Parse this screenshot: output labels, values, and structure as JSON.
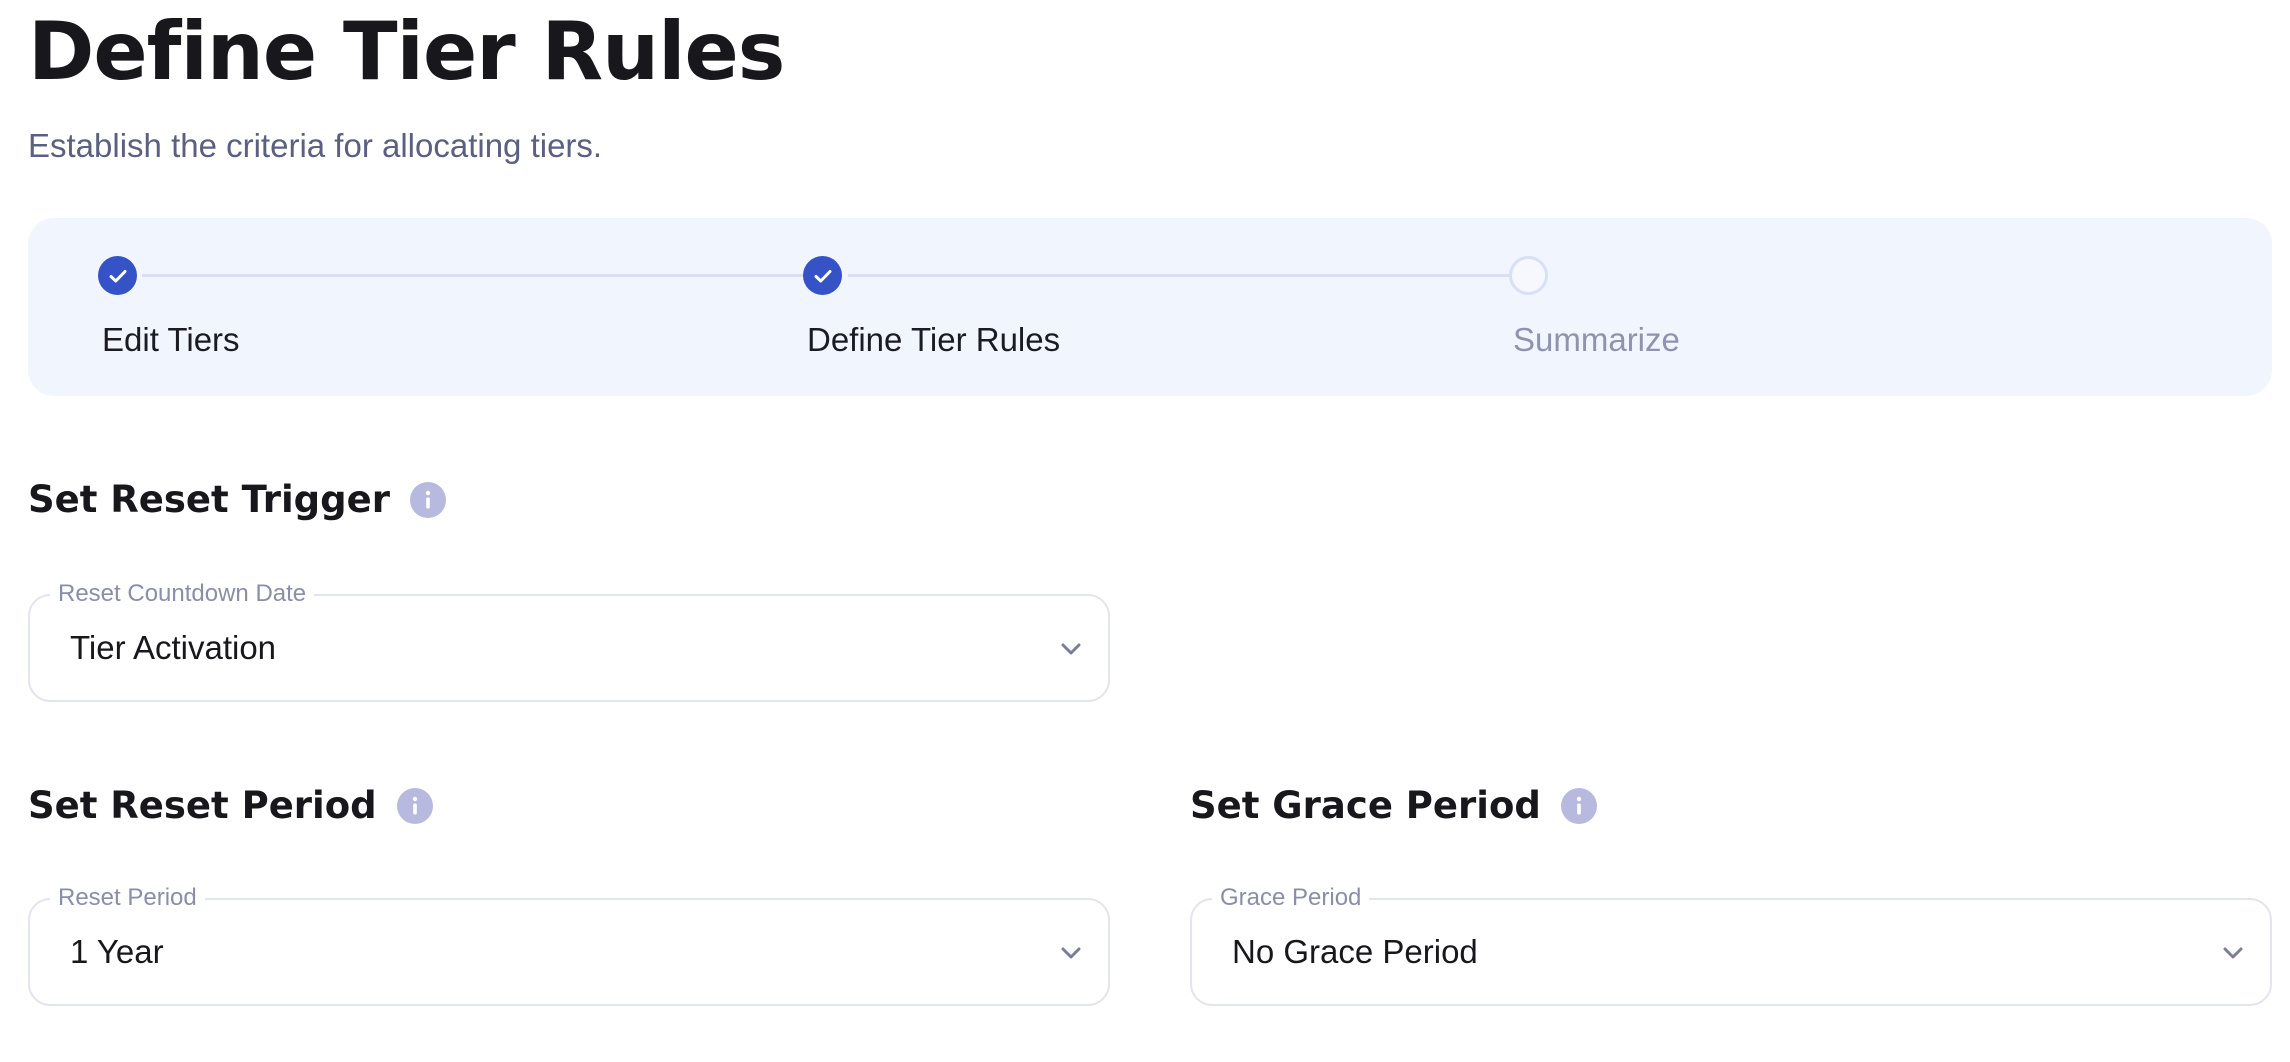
{
  "header": {
    "title": "Define Tier Rules",
    "subtitle": "Establish the criteria for allocating tiers."
  },
  "stepper": {
    "steps": [
      {
        "label": "Edit Tiers",
        "status": "completed"
      },
      {
        "label": "Define Tier Rules",
        "status": "completed"
      },
      {
        "label": "Summarize",
        "status": "pending"
      }
    ]
  },
  "reset_trigger": {
    "title": "Set Reset Trigger",
    "field_label": "Reset Countdown Date",
    "value": "Tier Activation"
  },
  "reset_period": {
    "title": "Set Reset Period",
    "field_label": "Reset Period",
    "value": "1 Year"
  },
  "grace_period": {
    "title": "Set Grace Period",
    "field_label": "Grace Period",
    "value": "No Grace Period"
  },
  "icons": {
    "step_done": "check-icon",
    "info": "info-icon",
    "dropdown": "chevron-down-icon"
  },
  "colors": {
    "accent": "#3552c7",
    "stepper_bg": "#f1f5fd",
    "info_icon": "#b7b9de",
    "muted_text": "#8f93ad"
  }
}
